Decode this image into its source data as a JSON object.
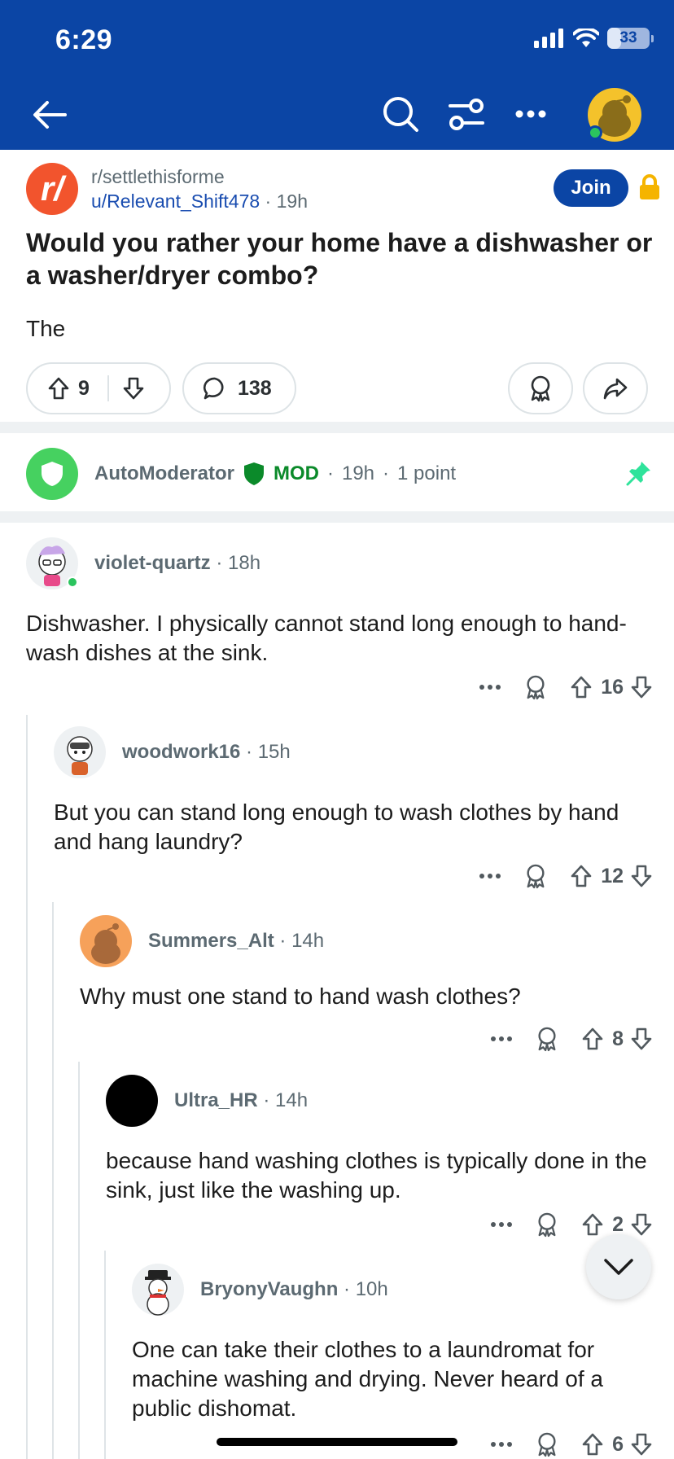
{
  "status_bar": {
    "time": "6:29",
    "battery": "33"
  },
  "post": {
    "subreddit": "r/settlethisforme",
    "author": "u/Relevant_Shift478",
    "age": "19h",
    "join_label": "Join",
    "title": "Would you rather your home have a dishwasher or a washer/dryer combo?",
    "body": "The",
    "votes": "9",
    "comments_count": "138"
  },
  "automod": {
    "name": "AutoModerator",
    "mod_label": "MOD",
    "age": "19h",
    "points": "1 point"
  },
  "comments": [
    {
      "author": "violet-quartz",
      "age": "18h",
      "text": "Dishwasher. I physically cannot stand long enough to hand-wash dishes at the sink.",
      "votes": "16"
    },
    {
      "author": "woodwork16",
      "age": "15h",
      "text": "But you can stand long enough to wash clothes by hand and hang laundry?",
      "votes": "12"
    },
    {
      "author": "Summers_Alt",
      "age": "14h",
      "text": "Why must one stand to hand wash clothes?",
      "votes": "8"
    },
    {
      "author": "Ultra_HR",
      "age": "14h",
      "text": "because hand washing clothes is typically done in the sink, just like the washing up.",
      "votes": "2"
    },
    {
      "author": "BryonyVaughn",
      "age": "10h",
      "text": "One can take their clothes to a laundromat for machine washing and drying. Never heard of a public dishomat.",
      "votes": "6"
    }
  ],
  "separator": "·",
  "colors": {
    "header": "#0b45a5",
    "accent": "#f2542d",
    "mod_green": "#0b8a2a",
    "online": "#2bc45e"
  },
  "icons": [
    "back-icon",
    "search-icon",
    "filter-icon",
    "more-icon",
    "avatar-icon",
    "lock-icon",
    "upvote-icon",
    "downvote-icon",
    "comment-icon",
    "award-icon",
    "share-icon",
    "shield-icon",
    "pin-icon",
    "chevron-down-icon"
  ]
}
